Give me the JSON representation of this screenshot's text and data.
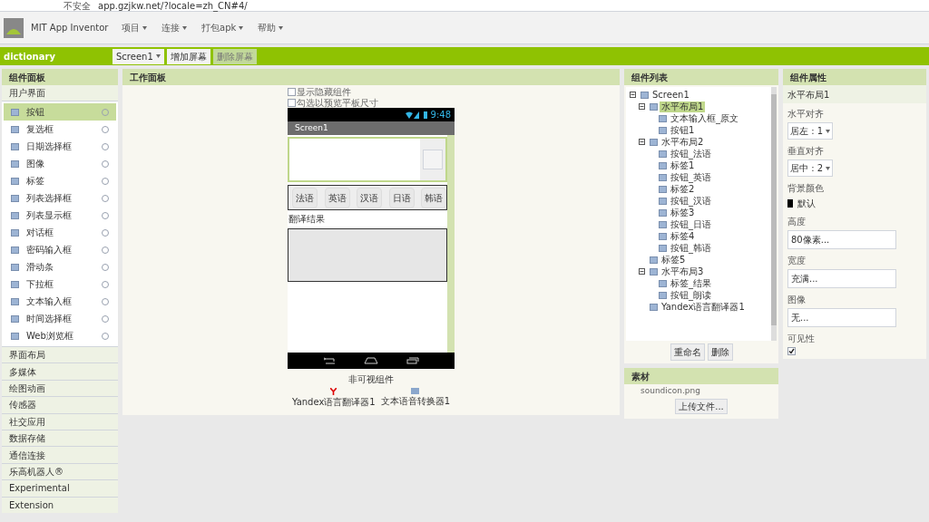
{
  "browser": {
    "security": "不安全",
    "url": "app.gzjkw.net/?locale=zh_CN#4/"
  },
  "header": {
    "logo": "MIT App Inventor",
    "menus": [
      "项目",
      "连接",
      "打包apk",
      "帮助"
    ]
  },
  "toolbar": {
    "project": "dictionary",
    "screen": "Screen1",
    "buttons": [
      {
        "label": "增加屏幕",
        "disabled": false
      },
      {
        "label": "删除屏幕",
        "disabled": true
      }
    ]
  },
  "palette": {
    "title": "组件面板",
    "open_category": "用户界面",
    "items": [
      {
        "label": "按钮",
        "selected": true
      },
      {
        "label": "复选框",
        "selected": false
      },
      {
        "label": "日期选择框",
        "selected": false
      },
      {
        "label": "图像",
        "selected": false
      },
      {
        "label": "标签",
        "selected": false
      },
      {
        "label": "列表选择框",
        "selected": false
      },
      {
        "label": "列表显示框",
        "selected": false
      },
      {
        "label": "对话框",
        "selected": false
      },
      {
        "label": "密码输入框",
        "selected": false
      },
      {
        "label": "滑动条",
        "selected": false
      },
      {
        "label": "下拉框",
        "selected": false
      },
      {
        "label": "文本输入框",
        "selected": false
      },
      {
        "label": "时间选择框",
        "selected": false
      },
      {
        "label": "Web浏览框",
        "selected": false
      }
    ],
    "categories": [
      "界面布局",
      "多媒体",
      "绘图动画",
      "传感器",
      "社交应用",
      "数据存储",
      "通信连接",
      "乐高机器人®",
      "Experimental",
      "Extension"
    ]
  },
  "viewer": {
    "title": "工作面板",
    "options": [
      {
        "label": "显示隐藏组件",
        "checked": false
      },
      {
        "label": "勾选以预览平板尺寸",
        "checked": false
      }
    ],
    "phone": {
      "time": "9:48",
      "screen_title": "Screen1",
      "buttons": [
        "法语",
        "英语",
        "汉语",
        "日语",
        "韩语"
      ],
      "result_label": "翻译结果"
    },
    "nonvisible_title": "非可视组件",
    "nonvisible": [
      "Yandex语言翻译器1",
      "文本语音转换器1"
    ]
  },
  "components": {
    "title": "组件列表",
    "tree": [
      {
        "label": "Screen1",
        "selected": false,
        "expanded": true,
        "children": [
          {
            "label": "水平布局1",
            "selected": true,
            "expanded": true,
            "children": [
              {
                "label": "文本输入框_原文",
                "selected": false
              },
              {
                "label": "按钮1",
                "selected": false
              }
            ]
          },
          {
            "label": "水平布局2",
            "selected": false,
            "expanded": true,
            "children": [
              {
                "label": "按钮_法语",
                "selected": false
              },
              {
                "label": "标签1",
                "selected": false
              },
              {
                "label": "按钮_英语",
                "selected": false
              },
              {
                "label": "标签2",
                "selected": false
              },
              {
                "label": "按钮_汉语",
                "selected": false
              },
              {
                "label": "标签3",
                "selected": false
              },
              {
                "label": "按钮_日语",
                "selected": false
              },
              {
                "label": "标签4",
                "selected": false
              },
              {
                "label": "按钮_韩语",
                "selected": false
              }
            ]
          },
          {
            "label": "标签5",
            "selected": false
          },
          {
            "label": "水平布局3",
            "selected": false,
            "expanded": true,
            "children": [
              {
                "label": "标签_结果",
                "selected": false
              },
              {
                "label": "按钮_朗读",
                "selected": false
              }
            ]
          },
          {
            "label": "Yandex语言翻译器1",
            "selected": false
          }
        ]
      }
    ],
    "buttons": [
      "重命名",
      "删除"
    ]
  },
  "media": {
    "title": "素材",
    "files": [
      "soundicon.png"
    ],
    "upload": "上传文件..."
  },
  "properties": {
    "title": "组件属性",
    "component": "水平布局1",
    "fields": [
      {
        "kind": "dropdown",
        "label": "水平对齐",
        "value": "居左 : 1"
      },
      {
        "kind": "dropdown",
        "label": "垂直对齐",
        "value": "居中 : 2"
      },
      {
        "kind": "color",
        "label": "背景颜色",
        "value": "默认",
        "color": "#000000"
      },
      {
        "kind": "text",
        "label": "高度",
        "value": "80像素..."
      },
      {
        "kind": "text",
        "label": "宽度",
        "value": "充满..."
      },
      {
        "kind": "text",
        "label": "图像",
        "value": "无..."
      },
      {
        "kind": "checkbox",
        "label": "可见性",
        "checked": true
      }
    ]
  }
}
